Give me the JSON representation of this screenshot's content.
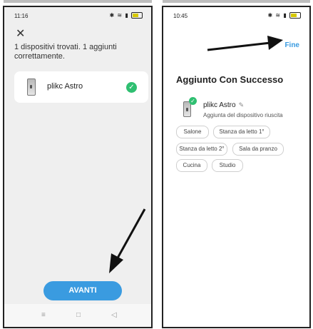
{
  "left_screen": {
    "status": {
      "time": "11:16"
    },
    "message": "1 dispositivi trovati. 1 aggiunti correttamente.",
    "device": {
      "name": "plikc Astro"
    },
    "button_label": "AVANTI",
    "nav": {
      "menu": "≡",
      "home": "□",
      "back": "◁"
    }
  },
  "right_screen": {
    "status": {
      "time": "10:45"
    },
    "done_label": "Fine",
    "heading": "Aggiunto Con Successo",
    "device": {
      "name": "plikc Astro",
      "subtitle": "Aggiunta del dispositivo riuscita"
    },
    "rooms": [
      "Salone",
      "Stanza da letto 1°",
      "Stanza da letto 2°",
      "Sala da pranzo",
      "Cucina",
      "Studio"
    ]
  },
  "colors": {
    "accent": "#3a9be0",
    "success": "#2fbf71"
  },
  "icons": {
    "close": "close-icon",
    "check": "check-icon",
    "edit": "pencil-icon",
    "device": "device-icon"
  }
}
